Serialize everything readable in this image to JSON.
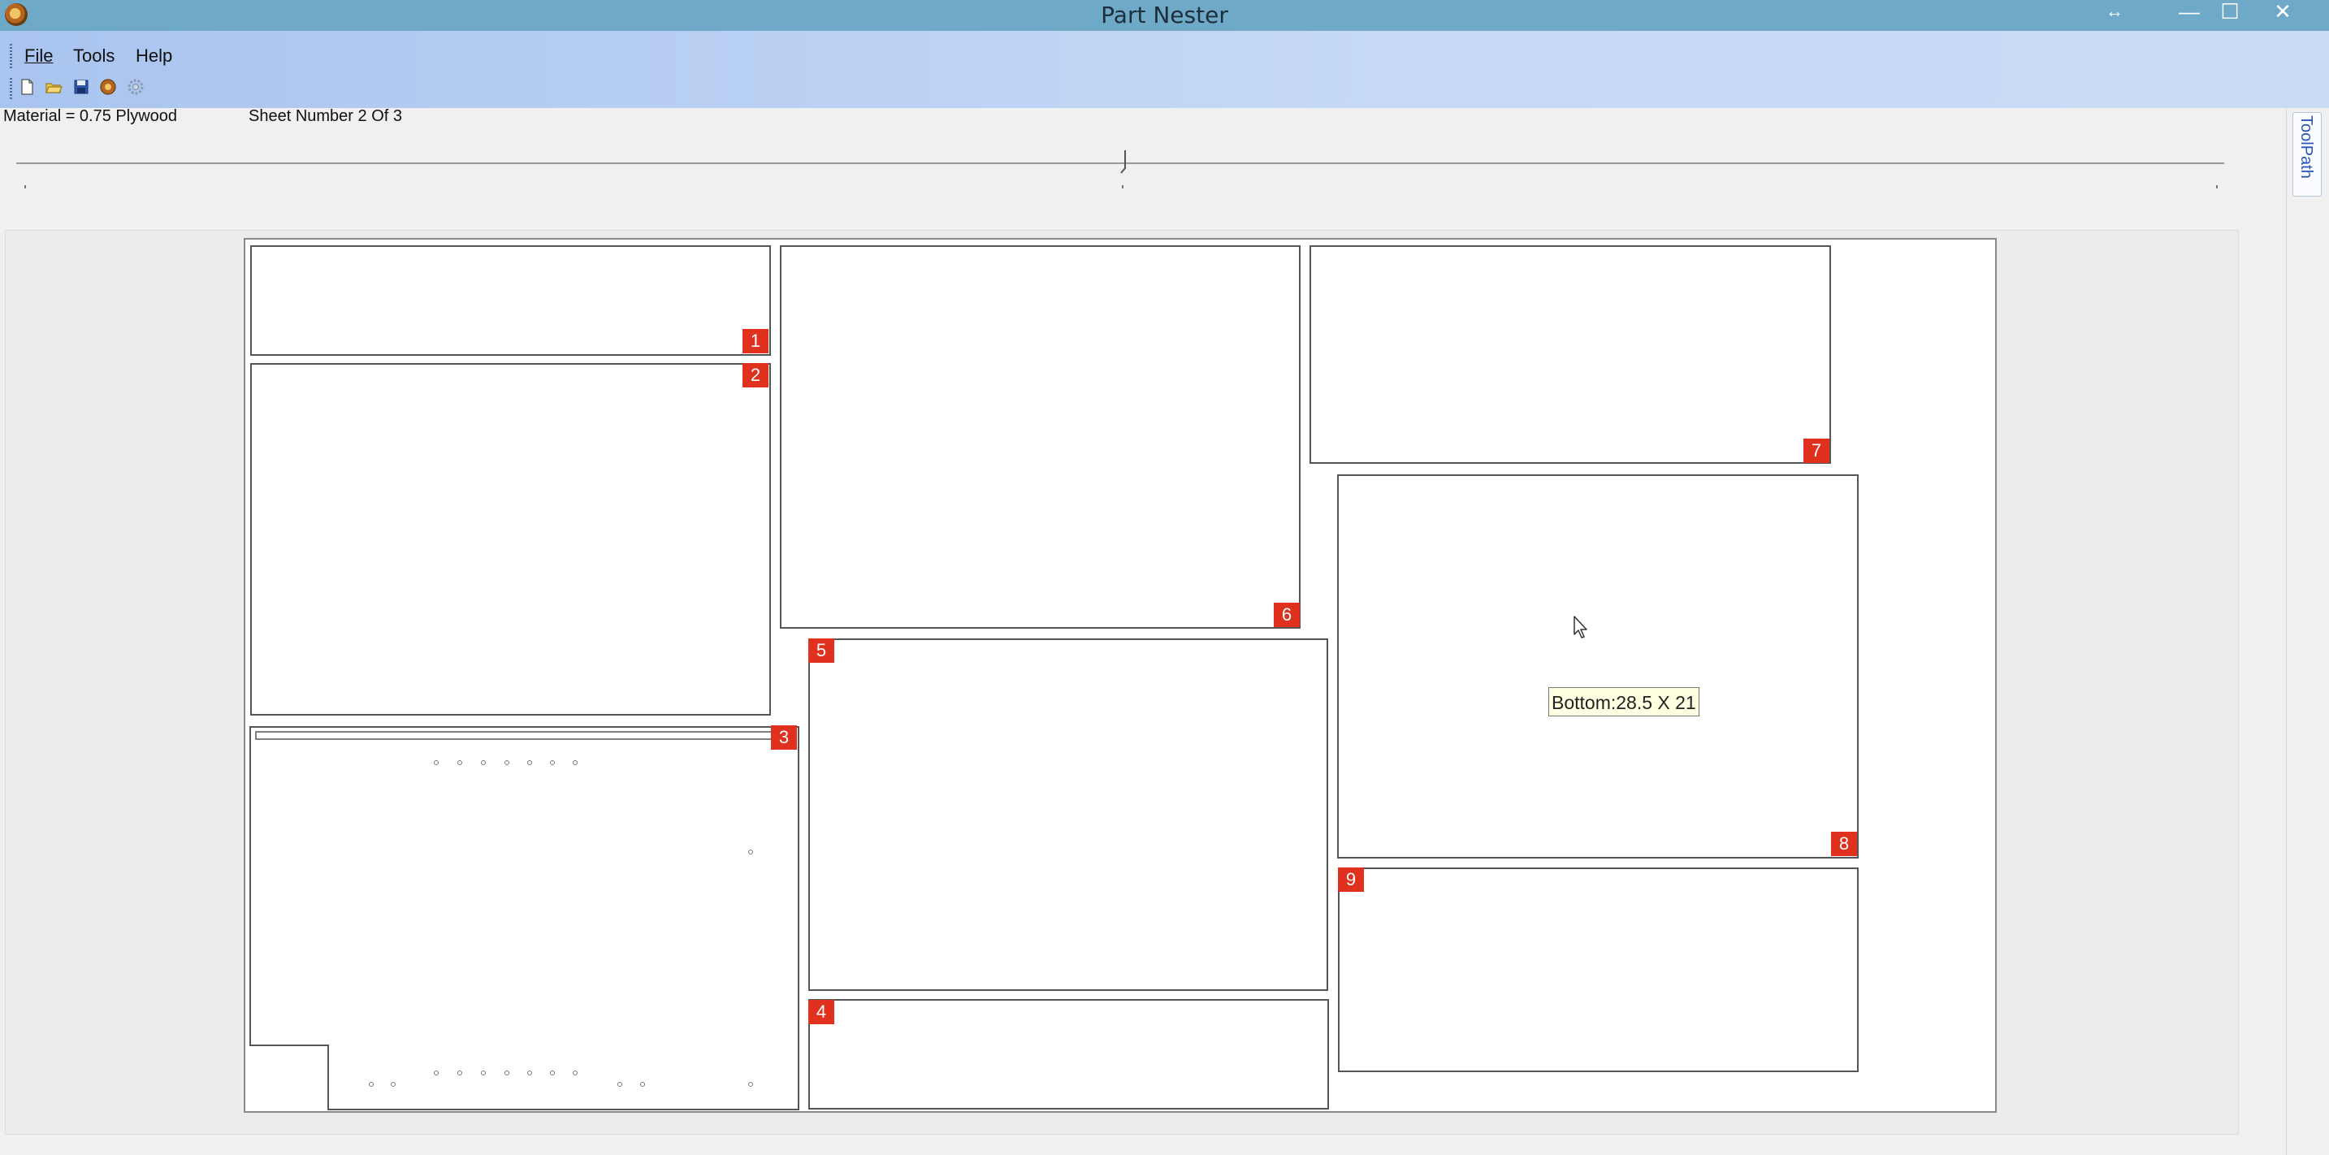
{
  "window": {
    "title": "Part Nester",
    "controls": {
      "resize": "↔",
      "minimize": "—",
      "maximize": "☐",
      "close": "✕"
    }
  },
  "menu": {
    "file": "File",
    "tools": "Tools",
    "help": "Help"
  },
  "toolbar": {
    "icons": [
      "new-file-icon",
      "open-folder-icon",
      "save-icon",
      "nest-icon",
      "settings-icon"
    ]
  },
  "info": {
    "material": "Material  = 0.75 Plywood",
    "sheet_number": "Sheet Number 2 Of 3"
  },
  "side_panel": {
    "tab_label": "ToolPath"
  },
  "parts": [
    {
      "label": "1"
    },
    {
      "label": "2"
    },
    {
      "label": "3"
    },
    {
      "label": "4"
    },
    {
      "label": "5"
    },
    {
      "label": "6"
    },
    {
      "label": "7"
    },
    {
      "label": "8"
    },
    {
      "label": "9"
    }
  ],
  "tooltip": "Bottom:28.5 X 21",
  "colors": {
    "title_bar": "#6ea9c8",
    "menu_bar": "#b9d0f3",
    "part_badge": "#e0301e",
    "tooltip_bg": "#ffffe1",
    "sheet": "#ffffff"
  }
}
